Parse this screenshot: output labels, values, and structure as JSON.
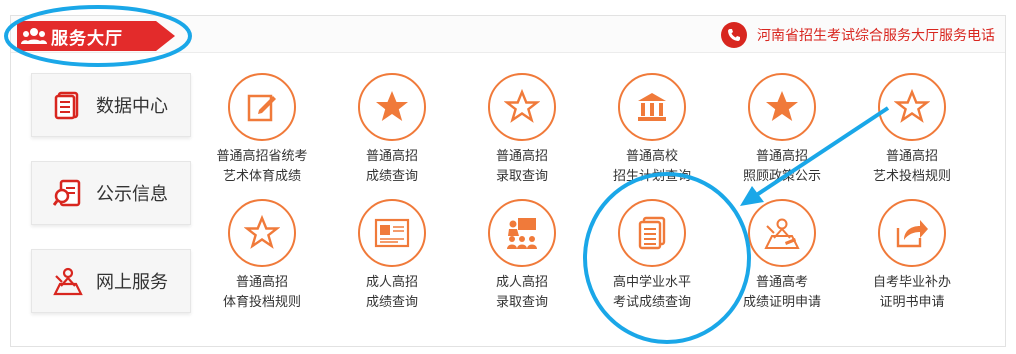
{
  "header": {
    "title": "服务大厅",
    "hotline": "河南省招生考试综合服务大厅服务电话"
  },
  "sidebar": [
    {
      "label": "数据中心"
    },
    {
      "label": "公示信息"
    },
    {
      "label": "网上服务"
    }
  ],
  "tiles": [
    {
      "line1": "普通高招省统考",
      "line2": "艺术体育成绩",
      "icon": "edit-icon"
    },
    {
      "line1": "普通高招",
      "line2": "成绩查询",
      "icon": "star-solid-icon"
    },
    {
      "line1": "普通高招",
      "line2": "录取查询",
      "icon": "star-outline-icon"
    },
    {
      "line1": "普通高校",
      "line2": "招生计划查询",
      "icon": "building-icon"
    },
    {
      "line1": "普通高招",
      "line2": "照顾政策公示",
      "icon": "star-solid-icon"
    },
    {
      "line1": "普通高招",
      "line2": "艺术投档规则",
      "icon": "star-outline-icon"
    },
    {
      "line1": "普通高招",
      "line2": "体育投档规则",
      "icon": "star-outline-icon"
    },
    {
      "line1": "成人高招",
      "line2": "成绩查询",
      "icon": "certificate-icon"
    },
    {
      "line1": "成人高招",
      "line2": "录取查询",
      "icon": "lecture-icon"
    },
    {
      "line1": "高中学业水平",
      "line2": "考试成绩查询",
      "icon": "document-icon"
    },
    {
      "line1": "普通高考",
      "line2": "成绩证明申请",
      "icon": "applicant-icon"
    },
    {
      "line1": "自考毕业补办",
      "line2": "证明书申请",
      "icon": "share-icon"
    }
  ],
  "colors": {
    "accent": "#e32b2b",
    "icon_orange": "#f07a3a",
    "annotation_blue": "#1aa7e8"
  }
}
